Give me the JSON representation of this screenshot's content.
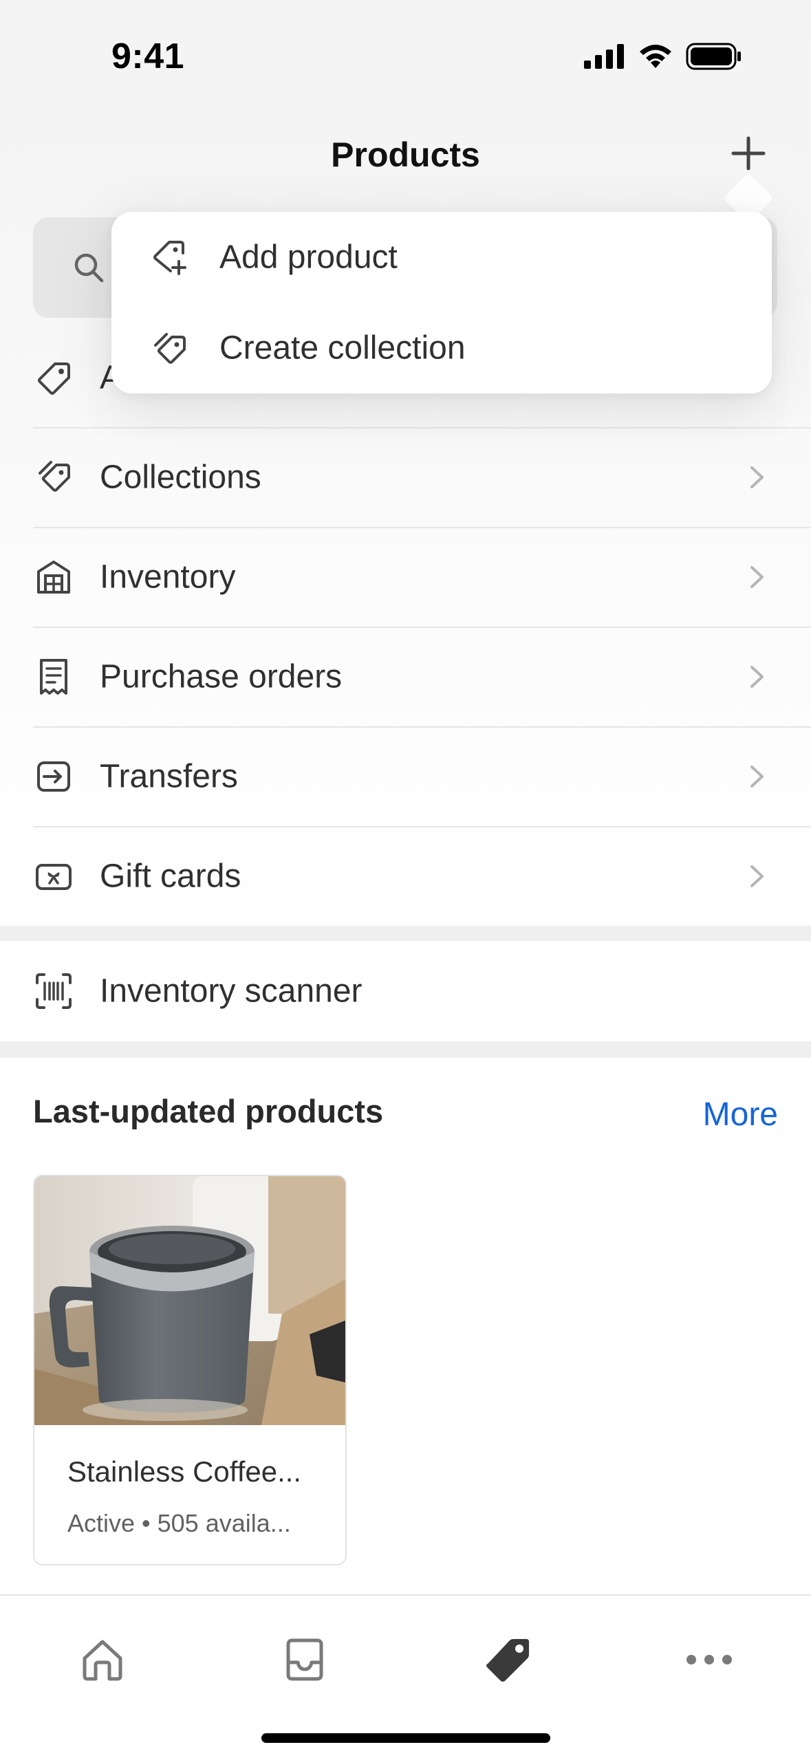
{
  "status_bar": {
    "time": "9:41"
  },
  "header": {
    "title": "Products"
  },
  "popover": {
    "items": [
      {
        "label": "Add product",
        "icon": "tag-plus-icon"
      },
      {
        "label": "Create collection",
        "icon": "tags-icon"
      }
    ]
  },
  "menu": {
    "partial_label": "A",
    "items": [
      {
        "label": "Collections",
        "icon": "tags-icon"
      },
      {
        "label": "Inventory",
        "icon": "warehouse-icon"
      },
      {
        "label": "Purchase orders",
        "icon": "receipt-icon"
      },
      {
        "label": "Transfers",
        "icon": "transfer-icon"
      },
      {
        "label": "Gift cards",
        "icon": "gift-card-icon"
      }
    ],
    "scanner_label": "Inventory scanner"
  },
  "last_updated": {
    "title": "Last-updated products",
    "more_label": "More",
    "products": [
      {
        "name": "Stainless Coffee...",
        "meta": "Active • 505 availa..."
      }
    ]
  },
  "tab_bar": {
    "tabs": [
      {
        "icon": "home-icon"
      },
      {
        "icon": "inbox-icon"
      },
      {
        "icon": "tag-icon",
        "active": true
      },
      {
        "icon": "more-icon"
      }
    ]
  },
  "colors": {
    "accent_link": "#1565d8",
    "text": "#303030",
    "divider": "#e5e5e5"
  }
}
